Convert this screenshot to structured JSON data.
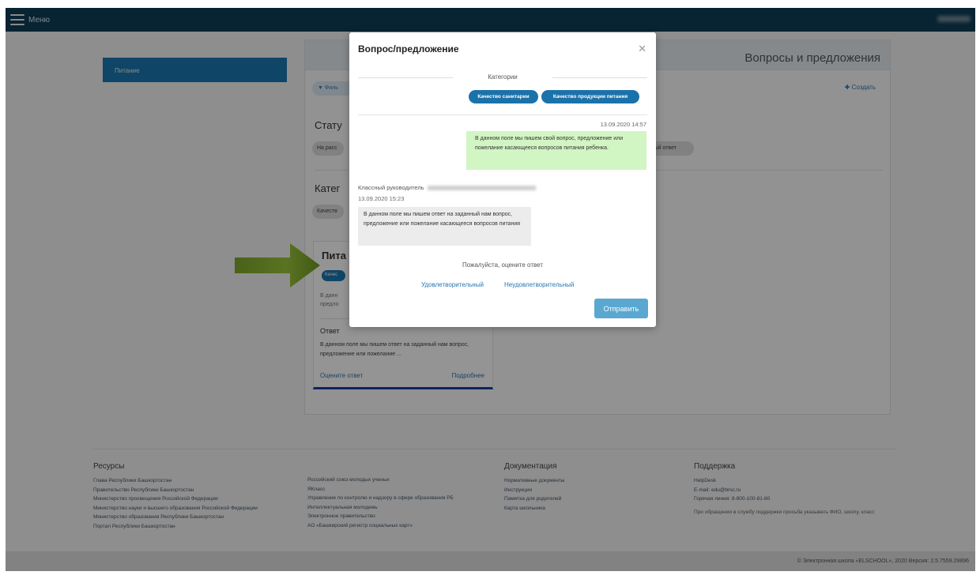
{
  "topbar": {
    "menu_label": "Меню"
  },
  "sidebar": {
    "items": [
      {
        "label": "Питание"
      }
    ]
  },
  "panel": {
    "title": "Вопросы и предложения",
    "filter_label": "Филь",
    "create_label": "Создать",
    "status_title": "Стату",
    "status_chip_left": "На расс",
    "status_chip_right": "льный ответ",
    "category_title": "Катег",
    "category_chip": "Качеств"
  },
  "card": {
    "title": "Пита",
    "chip": "Качес",
    "question_preview": "В данн предло",
    "answer_label": "Ответ",
    "answer_text": "В данном поле мы пишем ответ на заданный нам вопрос, предложение или пожелание ...",
    "rate_link": "Оцените ответ",
    "more_link": "Подробнее"
  },
  "modal": {
    "title": "Вопрос/предложение",
    "categories_label": "Категории",
    "categories": [
      "Качество санитарии",
      "Качество продукции питания"
    ],
    "outgoing": {
      "date": "13.09.2020 14:57",
      "text": "В данном поле мы пишем свой вопрос, предложение или пожелание касающееся вопросов питания ребенка."
    },
    "incoming": {
      "author": "Классный руководитель",
      "date": "13.09.2020 15:23",
      "text": "В данном поле мы пишем ответ на заданный нам вопрос, предложение или пожелание касающееся вопросов питания"
    },
    "rate_prompt": "Пожалуйста, оцените ответ",
    "rate_good": "Удовлетворительный",
    "rate_bad": "Неудовлетворительный",
    "send_label": "Отправить"
  },
  "footer": {
    "resources": {
      "title": "Ресурсы",
      "links_a": [
        "Глава Республики Башкортостан",
        "Правительство Республики Башкортостан",
        "Министерство просвещения Российской Федерации",
        "Министерство науки и высшего образования Российской Федерации",
        "Министерство образования Республики Башкортостан",
        "Портал Республики Башкортостан"
      ],
      "links_b": [
        "Российский союз молодых ученых",
        "ЯКласс",
        "Управление по контролю и надзору в сфере образования РБ",
        "Интеллектуальная молодежь",
        "Электронное правительство",
        "АО «Башкирский регистр социальных карт»"
      ]
    },
    "docs": {
      "title": "Документация",
      "links": [
        "Нормативные документы",
        "Инструкции",
        "Памятка для родителей",
        "Карта школьника"
      ]
    },
    "support": {
      "title": "Поддержка",
      "links": [
        "HelpDesk",
        "E-mail: edu@brsc.ru",
        "Горячая линия: 8-800-100-81-80"
      ],
      "note": "При обращении в службу поддержки просьба указывать ФИО, школу, класс"
    },
    "copyright": "© Электронная школа «ELSCHOOL», 2020 Версия: 2.5.7559.29896"
  }
}
